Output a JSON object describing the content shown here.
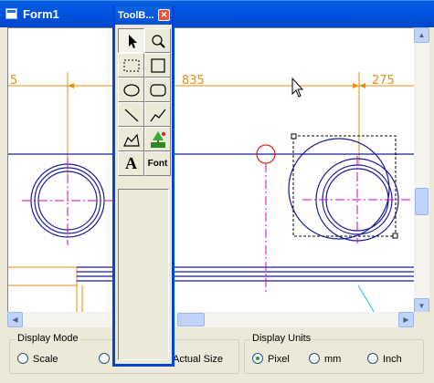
{
  "window": {
    "title": "Form1"
  },
  "toolbox": {
    "title": "ToolB...",
    "close_glyph": "✕",
    "tools": [
      {
        "name": "pointer-tool",
        "icon": "arrow-pointer-icon",
        "pressed": true
      },
      {
        "name": "zoom-tool",
        "icon": "magnifier-icon"
      },
      {
        "name": "select-rect-tool",
        "icon": "dashed-rectangle-icon"
      },
      {
        "name": "rectangle-tool",
        "icon": "rectangle-icon"
      },
      {
        "name": "ellipse-tool",
        "icon": "ellipse-icon"
      },
      {
        "name": "rounded-rect-tool",
        "icon": "rounded-rectangle-icon"
      },
      {
        "name": "line-tool",
        "icon": "line-icon"
      },
      {
        "name": "polyline-tool",
        "icon": "polyline-icon"
      },
      {
        "name": "polygon-tool",
        "icon": "polygon-icon"
      },
      {
        "name": "image-tool",
        "icon": "tree-image-icon"
      },
      {
        "name": "text-tool",
        "icon": "text-a-icon",
        "label": "A"
      },
      {
        "name": "font-tool",
        "icon": "font-icon",
        "label": "Font"
      }
    ]
  },
  "drawing": {
    "dimensions": [
      "5",
      "835",
      "275"
    ],
    "colors": {
      "dimension": "#e8900a",
      "geometry": "#1a1aa0",
      "centerline": "#d000c0",
      "marker": "#d62020",
      "leader": "#20c0e0"
    }
  },
  "display_mode": {
    "label": "Display Mode",
    "options": [
      {
        "label": "Scale",
        "checked": false
      },
      {
        "label": "Actual Size",
        "checked": false
      }
    ]
  },
  "display_units": {
    "label": "Display Units",
    "options": [
      {
        "label": "Pixel",
        "checked": true
      },
      {
        "label": "mm",
        "checked": false
      },
      {
        "label": "Inch",
        "checked": false
      }
    ]
  },
  "scroll": {
    "up": "▲",
    "down": "▼",
    "left": "◀",
    "right": "▶"
  }
}
